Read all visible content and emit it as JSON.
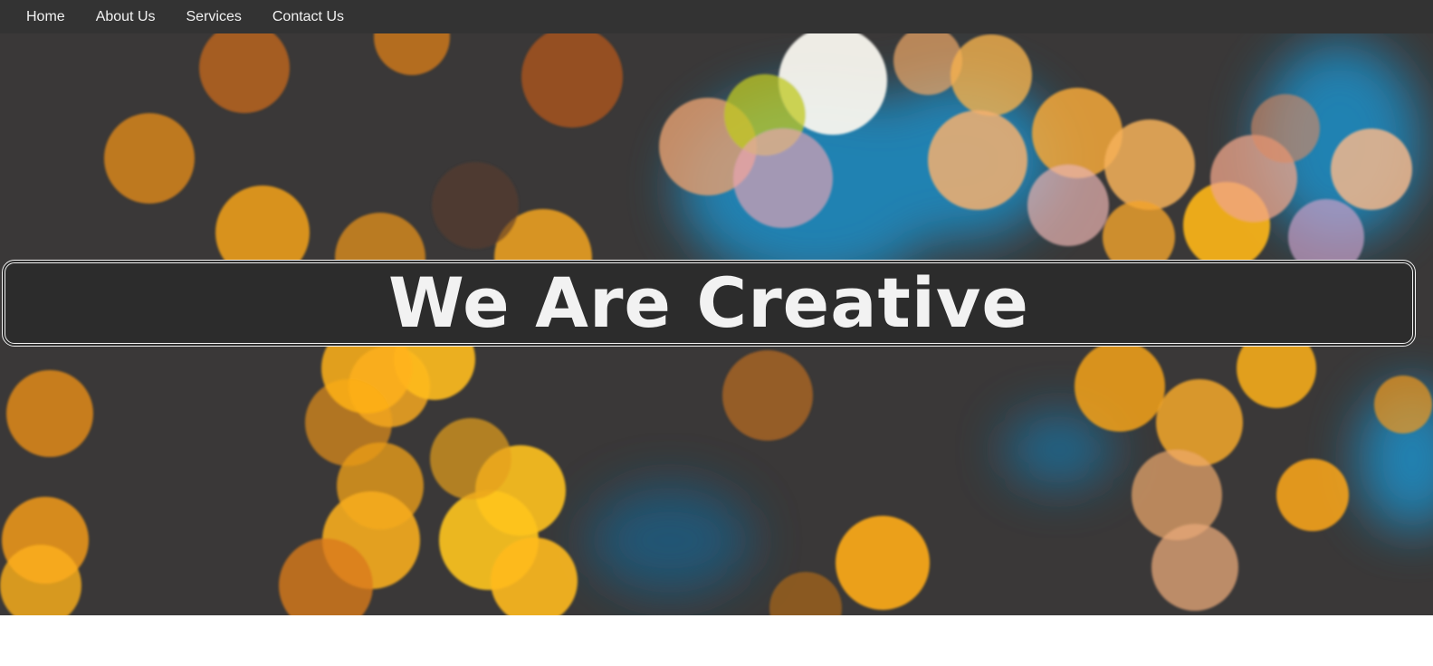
{
  "nav": {
    "items": [
      {
        "label": "Home"
      },
      {
        "label": "About Us"
      },
      {
        "label": "Services"
      },
      {
        "label": "Contact Us"
      }
    ]
  },
  "hero": {
    "headline": "We Are Creative",
    "background_description_colors": {
      "base": "#3a3838",
      "orange": "#f5a21a",
      "yellow": "#ffc21f",
      "blue": "#1e8fc8",
      "peach": "#f0b489"
    }
  },
  "theme": {
    "nav_background": "#333333",
    "nav_text": "#f2f2f2",
    "headline_box_background": "#2c2c2c",
    "headline_text": "#f2f2f2"
  }
}
